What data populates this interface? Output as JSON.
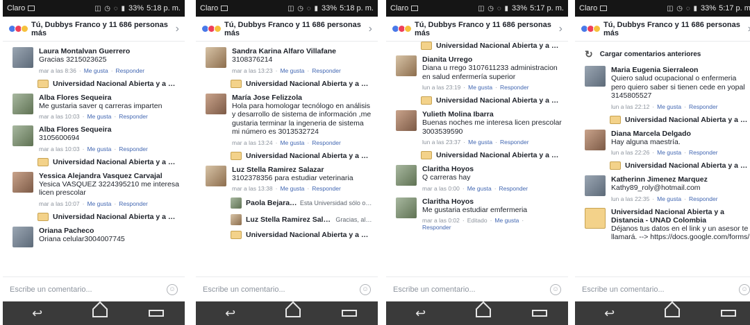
{
  "phones": [
    {
      "status": {
        "carrier": "Claro",
        "battery": "33%",
        "time": "5:18 p. m."
      },
      "header": {
        "text": "Tú, Dubbys Franco y 11 686 personas más"
      },
      "comments": [
        {
          "name": "Laura Montalvan Guerrero",
          "text": "Gracias 3215023625",
          "meta": "mar a las 8:36"
        },
        {
          "name": "Alba Flores Sequeira",
          "text": "Me gustaria saver q carreras imparten",
          "meta": "mar a las 10:03"
        },
        {
          "name": "Alba Flores Sequeira",
          "text": "3105600694",
          "meta": "mar a las 10:03"
        },
        {
          "name": "Yessica Alejandra Vasquez Carvajal",
          "text": "Yesica VASQUEZ 3224395210 me interesa licen prescolar",
          "meta": "mar a las 10:07"
        },
        {
          "name": "Oriana Pacheco",
          "text": "Oriana celular3004007745",
          "meta": ""
        }
      ],
      "replies": [
        {
          "name": "Universidad Nacional Abierta y a Dist..."
        },
        {
          "name": "Universidad Nacional Abierta y a Dist..."
        },
        {
          "name": "Universidad Nacional Abierta y a Dist..."
        }
      ],
      "composer_placeholder": "Escribe un comentario..."
    },
    {
      "status": {
        "carrier": "Claro",
        "battery": "33%",
        "time": "5:18 p. m."
      },
      "header": {
        "text": "Tú, Dubbys Franco y 11 686 personas más"
      },
      "comments": [
        {
          "name": "Sandra Karina Alfaro Villafane",
          "text": "3108376214",
          "meta": "mar a las 13:23"
        },
        {
          "name": "María Jose Felizzola",
          "text": "Hola para homologar tecnólogo en análisis y desarrollo de sistema de información ,me gustaria terminar la ingeneria de sistema mi número es 3013532724",
          "meta": "mar a las 13:24"
        },
        {
          "name": "Luz Stella Ramirez Salazar",
          "text": "3102378356 para estudiar veterinaria",
          "meta": "mar a las 13:38"
        }
      ],
      "replies": [
        {
          "name": "Universidad Nacional Abierta y a Dist..."
        },
        {
          "name": "Universidad Nacional Abierta y a Dist..."
        },
        {
          "name": "Paola Bejarano",
          "text": "Esta Universidad sólo ofr..."
        },
        {
          "name": "Luz Stella Ramirez Salazar",
          "text": "Gracias, alg..."
        },
        {
          "name": "Universidad Nacional Abierta y a Dist..."
        }
      ],
      "composer_placeholder": "Escribe un comentario..."
    },
    {
      "status": {
        "carrier": "Claro",
        "battery": "33%",
        "time": "5:17 p. m."
      },
      "header": {
        "text": "Tú, Dubbys Franco y 11 686 personas más"
      },
      "top_reply": "Universidad Nacional Abierta y a Dist...",
      "comments": [
        {
          "name": "Dianita Urrego",
          "text": "Diana u rrego 3107611233 administracion en salud enfermería superior",
          "meta": "lun a las 23:19"
        },
        {
          "name": "Yulieth Molina Ibarra",
          "text": "Buenas noches me interesa licen prescolar 3003539590",
          "meta": "lun a las 23:37"
        },
        {
          "name": "Claritha Hoyos",
          "text": "Q carreras hay",
          "meta": "mar a las 0:00"
        },
        {
          "name": "Claritha Hoyos",
          "text": "Me gustaria estudiar emfermeria",
          "meta": "mar a las 0:02",
          "edited": "Editado",
          "extra": "Responder"
        }
      ],
      "replies": [
        {
          "name": "Universidad Nacional Abierta y a Dist..."
        },
        {
          "name": "Universidad Nacional Abierta y a Dist..."
        }
      ],
      "composer_placeholder": "Escribe un comentario..."
    },
    {
      "status": {
        "carrier": "Claro",
        "battery": "33%",
        "time": "5:17 p. m."
      },
      "header": {
        "text": "Tú, Dubbys Franco y 11 686 personas más"
      },
      "load_previous": "Cargar comentarios anteriores",
      "comments": [
        {
          "name": "Maria Eugenia Sierraleon",
          "text": "Quiero salud ocupacional o enfermeria pero quiero saber si tienen cede en yopal 3145805527",
          "meta": "lun a las 22:12"
        },
        {
          "name": "Diana Marcela Delgado",
          "text": "Hay alguna maestría.",
          "meta": "lun a las 22:26"
        },
        {
          "name": "Katherinn Jimenez Marquez",
          "text": "Kathy89_roly@hotmail.com",
          "meta": "lun a las 22:35"
        },
        {
          "name": "Universidad Nacional Abierta y a Distancia - UNAD Colombia",
          "text": "Déjanos tus datos en el link y un asesor te llamará. --> https://docs.google.com/forms/",
          "meta": ""
        }
      ],
      "replies": [
        {
          "name": "Universidad Nacional Abierta y a Dist..."
        },
        {
          "name": "Universidad Nacional Abierta y a Dist..."
        }
      ],
      "composer_placeholder": "Escribe un comentario..."
    }
  ],
  "actions": {
    "like": "Me gusta",
    "reply": "Responder"
  }
}
